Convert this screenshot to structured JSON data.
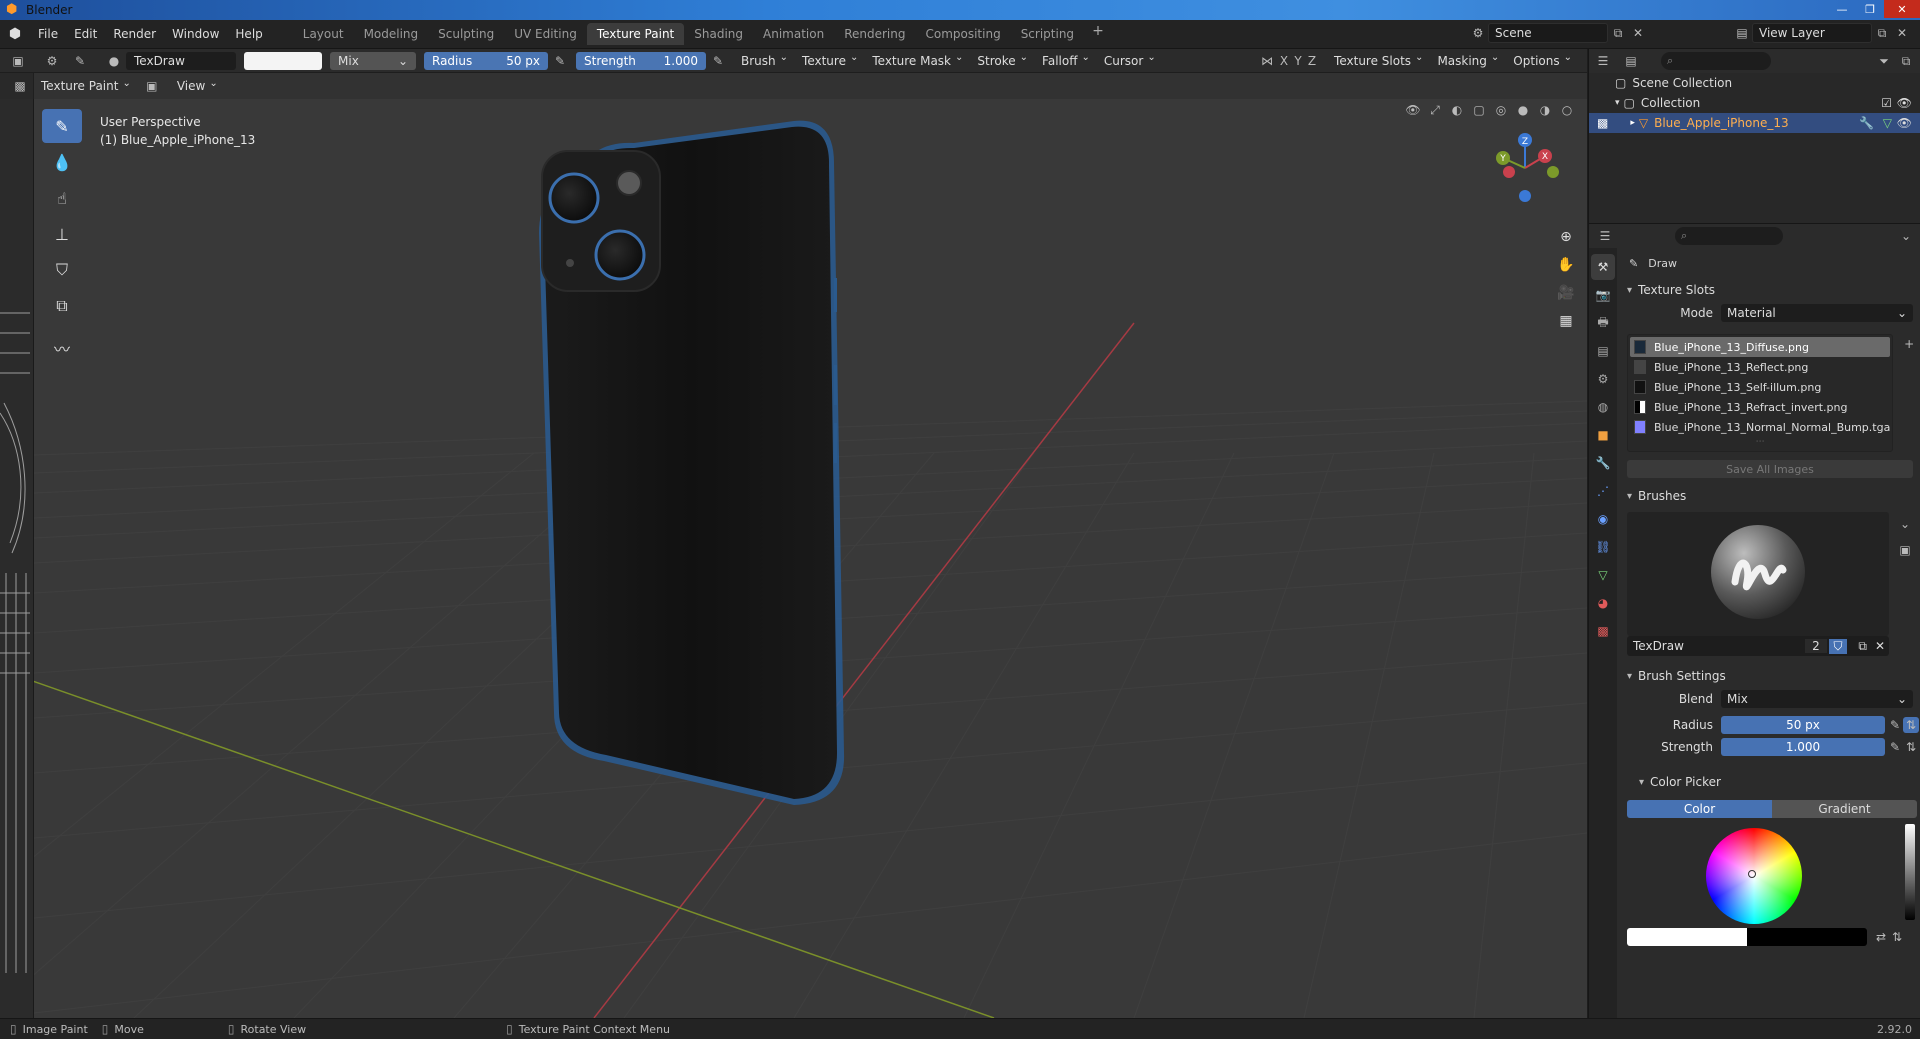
{
  "window": {
    "title": "Blender"
  },
  "menu": {
    "items": [
      "File",
      "Edit",
      "Render",
      "Window",
      "Help"
    ]
  },
  "workspaces": {
    "tabs": [
      "Layout",
      "Modeling",
      "Sculpting",
      "UV Editing",
      "Texture Paint",
      "Shading",
      "Animation",
      "Rendering",
      "Compositing",
      "Scripting"
    ],
    "active": "Texture Paint",
    "add": "+"
  },
  "scene": {
    "name": "Scene",
    "view_layer": "View Layer"
  },
  "tool_header": {
    "brush_name": "TexDraw",
    "blend": "Mix",
    "radius_label": "Radius",
    "radius_value": "50 px",
    "strength_label": "Strength",
    "strength_value": "1.000",
    "dropdowns": [
      "Brush",
      "Texture",
      "Texture Mask",
      "Stroke",
      "Falloff",
      "Cursor"
    ],
    "axis": [
      "X",
      "Y",
      "Z"
    ],
    "right_dropdowns": [
      "Texture Slots",
      "Masking",
      "Options"
    ]
  },
  "viewport_header": {
    "mode": "Texture Paint",
    "view": "View"
  },
  "viewport": {
    "perspective": "User Perspective",
    "object_label": "(1) Blue_Apple_iPhone_13",
    "gizmo_axes": [
      "X",
      "Y",
      "Z"
    ]
  },
  "outliner": {
    "scene_collection": "Scene Collection",
    "collection": "Collection",
    "object": "Blue_Apple_iPhone_13"
  },
  "properties": {
    "tool_name": "Draw",
    "texture_slots": {
      "title": "Texture Slots",
      "mode_label": "Mode",
      "mode_value": "Material",
      "slots": [
        "Blue_iPhone_13_Diffuse.png",
        "Blue_iPhone_13_Reflect.png",
        "Blue_iPhone_13_Self-illum.png",
        "Blue_iPhone_13_Refract_invert.png",
        "Blue_iPhone_13_Normal_Normal_Bump.tga"
      ],
      "save_all": "Save All Images"
    },
    "brushes": {
      "title": "Brushes",
      "name": "TexDraw",
      "users": "2"
    },
    "brush_settings": {
      "title": "Brush Settings",
      "blend_label": "Blend",
      "blend_value": "Mix",
      "radius_label": "Radius",
      "radius_value": "50 px",
      "strength_label": "Strength",
      "strength_value": "1.000"
    },
    "color_picker": {
      "title": "Color Picker",
      "tab_color": "Color",
      "tab_gradient": "Gradient"
    }
  },
  "statusbar": {
    "items": [
      "Image Paint",
      "Move",
      "Rotate View",
      "Texture Paint Context Menu"
    ],
    "version": "2.92.0"
  },
  "colors": {
    "accent": "#4772b3",
    "phone_body": "#151515",
    "phone_edge": "#2a5a8e",
    "x_axis": "#c9414d",
    "y_axis": "#7c9a2a",
    "z_axis": "#3b79d6"
  }
}
